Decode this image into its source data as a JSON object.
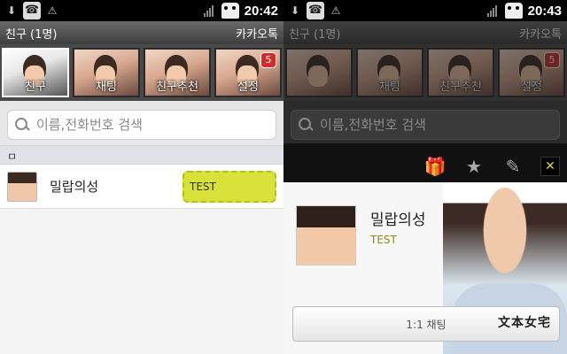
{
  "status": {
    "time_left": "20:42",
    "time_right": "20:43"
  },
  "title": {
    "left": "친구 (1명)",
    "right": "카카오톡"
  },
  "tabs": [
    {
      "label": "친구",
      "badge": ""
    },
    {
      "label": "채팅",
      "badge": ""
    },
    {
      "label": "친구추천",
      "badge": ""
    },
    {
      "label": "설정",
      "badge": "5"
    }
  ],
  "search": {
    "placeholder": "이름,전화번호 검색"
  },
  "section": {
    "header": "ㅁ"
  },
  "friend": {
    "name": "밀랍의성",
    "status_message": "TEST"
  },
  "profile": {
    "name": "밀랍의성",
    "status_message": "TEST",
    "chat_button": "1:1 채팅",
    "signature": "文本女宅"
  },
  "icons": {
    "download": "download-icon",
    "phone": "phone-icon",
    "warning": "warning-icon",
    "signal": "signal-icon",
    "android": "android-icon",
    "search": "search-icon",
    "gift": "gift-icon",
    "star": "star-icon",
    "edit": "pencil-icon",
    "close": "close-icon"
  },
  "colors": {
    "status_bubble": "#d8e238",
    "badge": "#d32b2b",
    "gift": "#e4c22d"
  }
}
